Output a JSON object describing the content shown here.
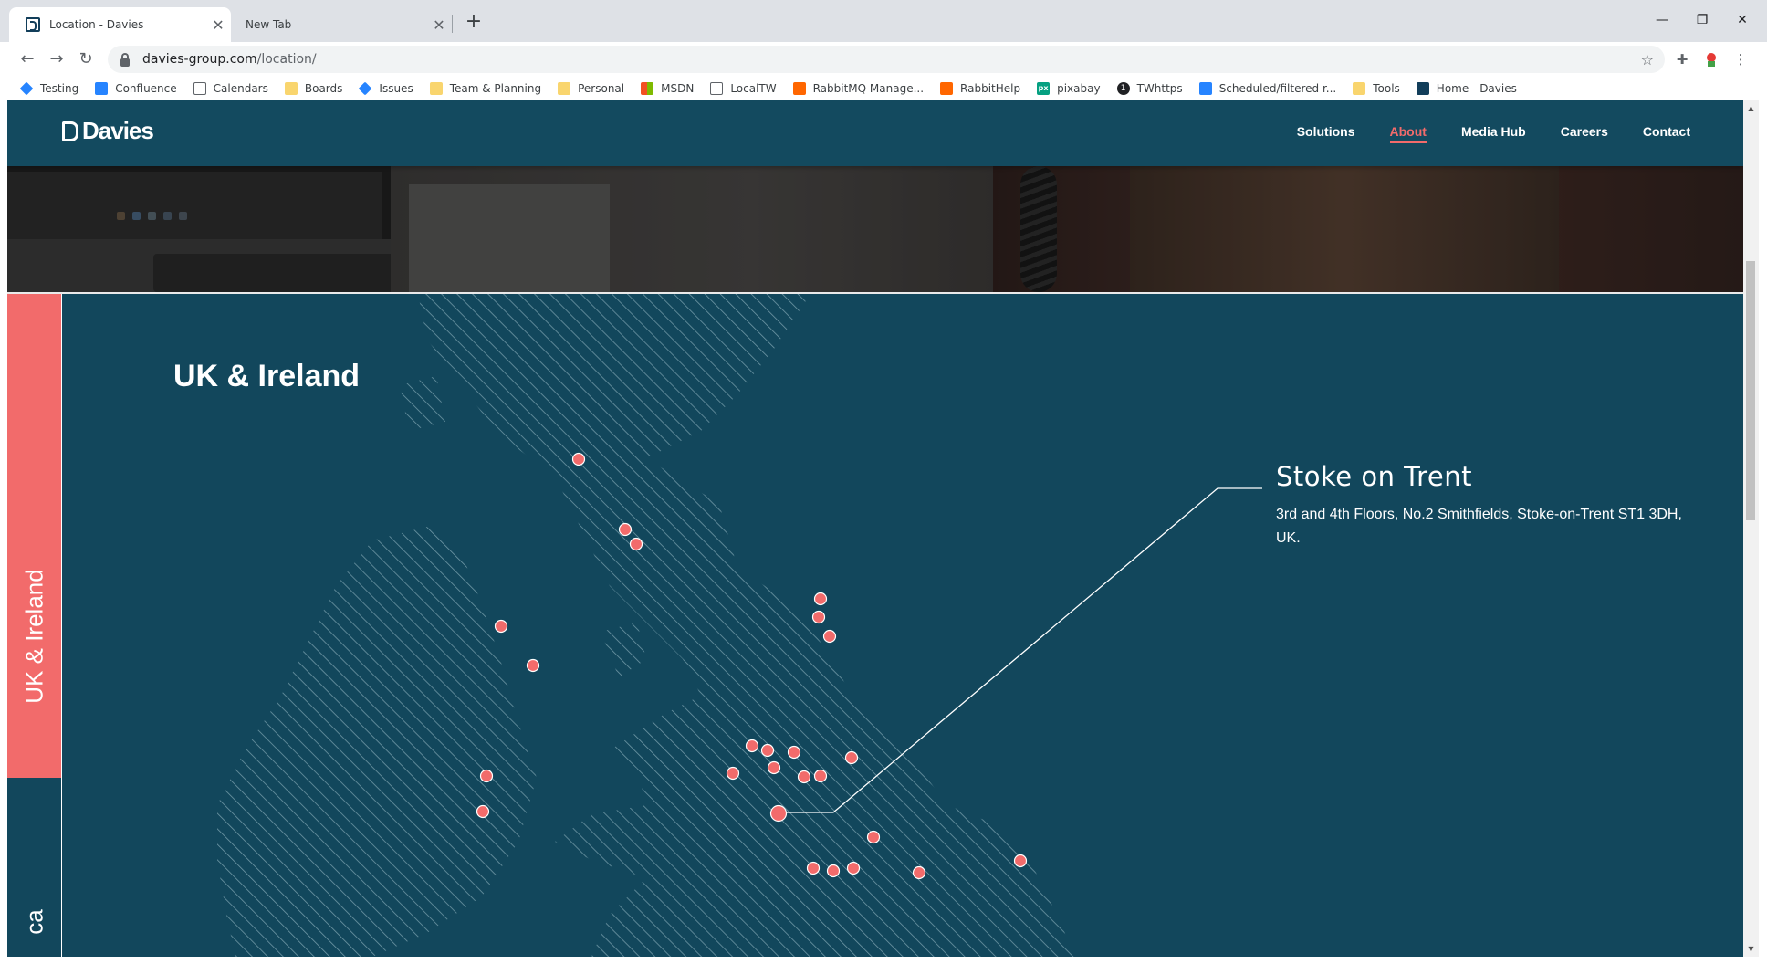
{
  "browser": {
    "tabs": [
      {
        "title": "Location - Davies",
        "close": "✕"
      },
      {
        "title": "New Tab",
        "close": "✕"
      }
    ],
    "new_tab": "+",
    "window_controls": {
      "minimize": "—",
      "restore": "❐",
      "close": "✕"
    },
    "url": {
      "domain": "davies-group.com",
      "path": "/location/"
    },
    "nav_icons": {
      "back": "←",
      "forward": "→",
      "reload": "↻"
    },
    "bookmarks": [
      {
        "label": "Testing",
        "icon": "jira-icon"
      },
      {
        "label": "Confluence",
        "icon": "confluence-icon"
      },
      {
        "label": "Calendars",
        "icon": "calendar-icon"
      },
      {
        "label": "Boards",
        "icon": "folder-icon"
      },
      {
        "label": "Issues",
        "icon": "jira-icon"
      },
      {
        "label": "Team & Planning",
        "icon": "folder-icon"
      },
      {
        "label": "Personal",
        "icon": "folder-icon"
      },
      {
        "label": "MSDN",
        "icon": "microsoft-icon"
      },
      {
        "label": "LocalTW",
        "icon": "monitor-icon"
      },
      {
        "label": "RabbitMQ Manage...",
        "icon": "rabbitmq-icon"
      },
      {
        "label": "RabbitHelp",
        "icon": "rabbitmq-icon"
      },
      {
        "label": "pixabay",
        "icon": "pixabay-icon"
      },
      {
        "label": "TWhttps",
        "icon": "1password-icon"
      },
      {
        "label": "Scheduled/filtered r...",
        "icon": "confluence-icon"
      },
      {
        "label": "Tools",
        "icon": "folder-icon"
      },
      {
        "label": "Home - Davies",
        "icon": "davies-icon"
      }
    ]
  },
  "site": {
    "logo": "Davies",
    "nav": [
      "Solutions",
      "About",
      "Media Hub",
      "Careers",
      "Contact"
    ],
    "active_nav": "About",
    "region_tabs": [
      "UK & Ireland",
      "ca"
    ],
    "region_heading": "UK & Ireland",
    "callout": {
      "title": "Stoke on Trent",
      "address": "3rd and 4th Floors, No.2 Smithfields, Stoke-on-Trent ST1 3DH, UK."
    }
  },
  "colors": {
    "page_bg": "#12475c",
    "header_bg": "#134a5f",
    "accent": "#f26b6b",
    "hatch": "#6f97a5",
    "marker": "#f26b6b"
  }
}
